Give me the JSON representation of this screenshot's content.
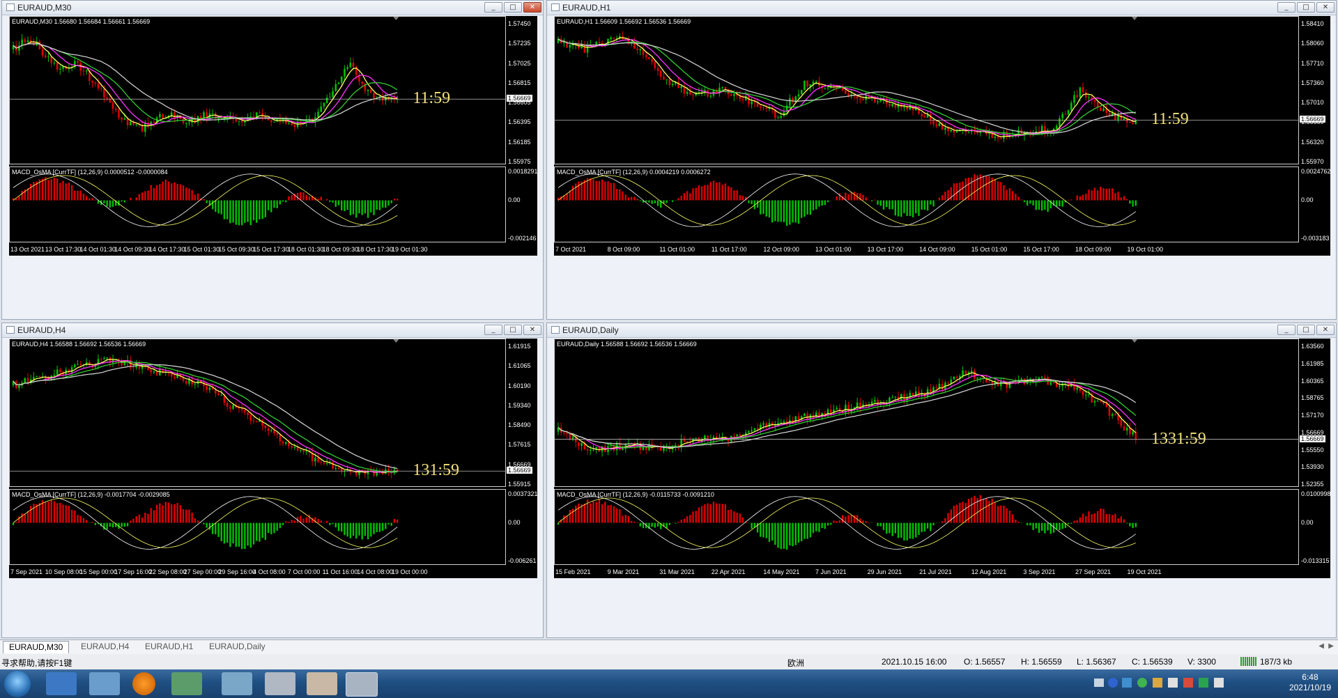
{
  "windows": [
    {
      "id": "m30",
      "title": "EURAUD,M30",
      "header": "EURAUD,M30  1.56680 1.56684 1.56661 1.56669",
      "timer": "11:59",
      "macd_header": "MACD_OsMA [CurrTF] (12,26,9) 0.0000512 -0.0000084",
      "price_labels": [
        "1.57450",
        "1.57235",
        "1.57025",
        "1.56815",
        "1.56605",
        "1.56395",
        "1.56185",
        "1.55975"
      ],
      "current_price": "1.56669",
      "macd_labels": [
        "0.0018291",
        "0.00",
        "-0.002146"
      ],
      "time_labels": [
        "13 Oct 2021",
        "13 Oct 17:30",
        "14 Oct 01:30",
        "14 Oct 09:30",
        "14 Oct 17:30",
        "15 Oct 01:30",
        "15 Oct 09:30",
        "15 Oct 17:30",
        "18 Oct 01:30",
        "18 Oct 09:30",
        "18 Oct 17:30",
        "19 Oct 01:30"
      ]
    },
    {
      "id": "h1",
      "title": "EURAUD,H1",
      "header": "EURAUD,H1  1.56609 1.56692 1.56536 1.56669",
      "timer": "11:59",
      "macd_header": "MACD_OsMA [CurrTF] (12,26,9) 0.0004219 0.0006272",
      "price_labels": [
        "1.58410",
        "1.58060",
        "1.57710",
        "1.57360",
        "1.57010",
        "1.56669",
        "1.56320",
        "1.55970"
      ],
      "current_price": "1.56669",
      "macd_labels": [
        "0.0024762",
        "0.00",
        "-0.003183"
      ],
      "time_labels": [
        "7 Oct 2021",
        "8 Oct 09:00",
        "11 Oct 01:00",
        "11 Oct 17:00",
        "12 Oct 09:00",
        "13 Oct 01:00",
        "13 Oct 17:00",
        "14 Oct 09:00",
        "15 Oct 01:00",
        "15 Oct 17:00",
        "18 Oct 09:00",
        "19 Oct 01:00"
      ]
    },
    {
      "id": "h4",
      "title": "EURAUD,H4",
      "header": "EURAUD,H4  1.56588 1.56692 1.56536 1.56669",
      "timer": "131:59",
      "macd_header": "MACD_OsMA [CurrTF] (12,26,9) -0.0017704 -0.0029085",
      "price_labels": [
        "1.61915",
        "1.61065",
        "1.60190",
        "1.59340",
        "1.58490",
        "1.57615",
        "1.56669",
        "1.55915"
      ],
      "current_price": "1.56669",
      "macd_labels": [
        "0.0037321",
        "0.00",
        "-0.006261"
      ],
      "time_labels": [
        "7 Sep 2021",
        "10 Sep 08:00",
        "15 Sep 00:00",
        "17 Sep 16:00",
        "22 Sep 08:00",
        "27 Sep 00:00",
        "29 Sep 16:00",
        "4 Oct 08:00",
        "7 Oct 00:00",
        "11 Oct 16:00",
        "14 Oct 08:00",
        "19 Oct 00:00"
      ]
    },
    {
      "id": "d1",
      "title": "EURAUD,Daily",
      "header": "EURAUD,Daily  1.56588 1.56692 1.56536 1.56669",
      "timer": "1331:59",
      "macd_header": "MACD_OsMA [CurrTF] (12,26,9) -0.0115733 -0.0091210",
      "price_labels": [
        "1.63560",
        "1.61985",
        "1.60365",
        "1.58765",
        "1.57170",
        "1.56669",
        "1.55550",
        "1.53930",
        "1.52355"
      ],
      "current_price": "1.56669",
      "macd_labels": [
        "0.0100998",
        "0.00",
        "-0.013315"
      ],
      "time_labels": [
        "15 Feb 2021",
        "9 Mar 2021",
        "31 Mar 2021",
        "22 Apr 2021",
        "14 May 2021",
        "7 Jun 2021",
        "29 Jun 2021",
        "21 Jul 2021",
        "12 Aug 2021",
        "3 Sep 2021",
        "27 Sep 2021",
        "19 Oct 2021"
      ]
    }
  ],
  "tabs": [
    "EURAUD,M30",
    "EURAUD,H4",
    "EURAUD,H1",
    "EURAUD,Daily"
  ],
  "status": {
    "help": "寻求帮助,请按F1键",
    "profile": "欧洲",
    "datetime": "2021.10.15 16:00",
    "open": "O: 1.56557",
    "high": "H: 1.56559",
    "low": "L: 1.56367",
    "close": "C: 1.56539",
    "volume": "V: 3300",
    "traffic": "187/3 kb"
  },
  "clock": {
    "time": "6:48",
    "date": "2021/10/19"
  },
  "colors": {
    "timer": "#f2e27a",
    "bull": "#00c000",
    "bear": "#e00000",
    "ma_yellow": "#ffff66",
    "ma_magenta": "#ff33ff",
    "ma_green": "#33cc33",
    "ma_gray": "#cccccc"
  }
}
